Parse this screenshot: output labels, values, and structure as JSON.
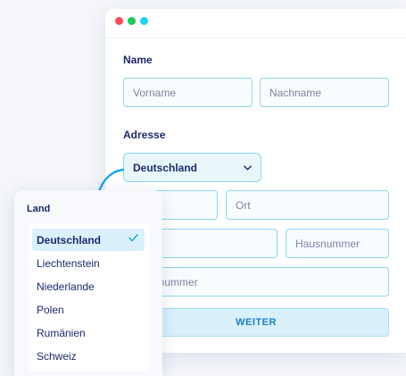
{
  "colors": {
    "dot_red": "#ff4b5c",
    "dot_green": "#22c55e",
    "dot_cyan": "#22d3ee",
    "accent": "#1fa2e0"
  },
  "form": {
    "name_label": "Name",
    "vorname_placeholder": "Vorname",
    "nachname_placeholder": "Nachname",
    "adresse_label": "Adresse",
    "country_select": {
      "value": "Deutschland",
      "icon": "chevron-down-icon"
    },
    "ort_placeholder": "Ort",
    "strasse_placeholder_visible": "e",
    "hausnummer_placeholder": "Hausnummer",
    "phone_placeholder_visible": "nnummer",
    "submit_label": "WEITER"
  },
  "dropdown": {
    "label": "Land",
    "selected_icon": "checkmark-icon",
    "options": [
      {
        "label": "Deutschland",
        "selected": true
      },
      {
        "label": "Liechtenstein"
      },
      {
        "label": "Niederlande"
      },
      {
        "label": "Polen"
      },
      {
        "label": "Rumänien"
      },
      {
        "label": "Schweiz"
      }
    ]
  }
}
